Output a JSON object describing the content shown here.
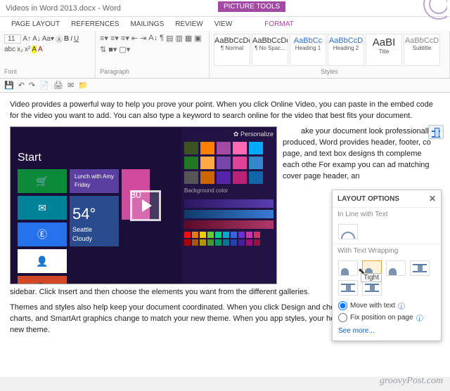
{
  "title": {
    "left": "Videos in Word 2013.docx - Word",
    "contextTab": "PICTURE TOOLS"
  },
  "tabs": [
    "PAGE LAYOUT",
    "REFERENCES",
    "MAILINGS",
    "REVIEW",
    "VIEW",
    "FORMAT"
  ],
  "ribbon": {
    "fontGroup": "Font",
    "fontSize": "11",
    "paraGroup": "Paragraph",
    "stylesGroup": "Styles",
    "styles": [
      {
        "s": "AaBbCcDc",
        "n": "¶ Normal"
      },
      {
        "s": "AaBbCcDc",
        "n": "¶ No Spac..."
      },
      {
        "s": "AaBbCc",
        "n": "Heading 1"
      },
      {
        "s": "AaBbCcD",
        "n": "Heading 2"
      },
      {
        "s": "AaBI",
        "n": "Title"
      },
      {
        "s": "AaBbCcD",
        "n": "Subtitle"
      }
    ]
  },
  "doc": {
    "p1": "Video provides a powerful way to help you prove your point. When you click Online Video, you can paste in the embed code for the video you want to add. You can also type a keyword to search online for the video that best fits your document.",
    "sideText": "ake your document look professionally produced, Word provides header, footer, co page, and text box designs th compleme each othe For examp you can ad matching cover page header, an",
    "p2": "sidebar. Click Insert and then choose the elements you want from the different galleries.",
    "p3": "Themes and styles also help keep your document coordinated. When you click Design and choose a n Theme, the pictures, charts, and SmartArt graphics change to match your new theme. When you app styles, your headings change to match the new theme."
  },
  "video": {
    "start": "Start",
    "personalize": "✿ Personalize",
    "temp": "54°",
    "city": "Seattle",
    "cond": "Cloudy",
    "date": "30"
  },
  "layout": {
    "title": "LAYOUT OPTIONS",
    "s1": "In Line with Text",
    "s2": "With Text Wrapping",
    "tooltip": "Tight",
    "r1": "Move with text",
    "r2": "Fix position on page",
    "more": "See more..."
  },
  "watermark": "groovyPost.com"
}
